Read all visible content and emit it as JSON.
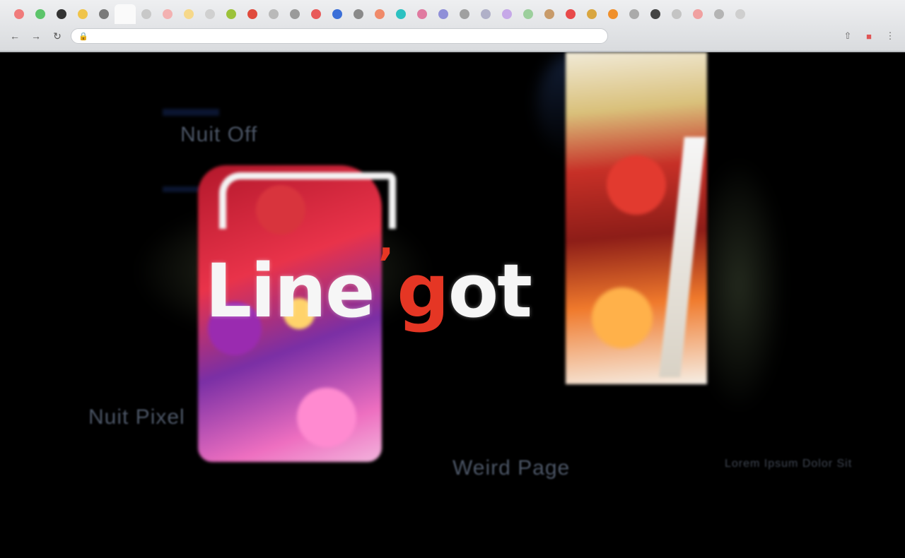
{
  "browser": {
    "tab_favicons": [
      {
        "name": "tab-1",
        "color": "#f07b7b"
      },
      {
        "name": "tab-2",
        "color": "#5cc46a"
      },
      {
        "name": "tab-3",
        "color": "#333333"
      },
      {
        "name": "tab-4",
        "color": "#f0c44a"
      },
      {
        "name": "tab-5",
        "color": "#7a7a7a"
      },
      {
        "name": "tab-6",
        "color": "#fafafa"
      },
      {
        "name": "tab-7",
        "color": "#c8c8c8"
      },
      {
        "name": "tab-8",
        "color": "#f3b1b1"
      },
      {
        "name": "tab-9",
        "color": "#f6d88a"
      },
      {
        "name": "tab-10",
        "color": "#d0d0d0"
      },
      {
        "name": "tab-11",
        "color": "#9cc23a"
      },
      {
        "name": "tab-12",
        "color": "#e04a3c"
      },
      {
        "name": "tab-13",
        "color": "#b9b9b9"
      },
      {
        "name": "tab-14",
        "color": "#9a9a9a"
      },
      {
        "name": "tab-15",
        "color": "#e85a5a"
      },
      {
        "name": "tab-16",
        "color": "#3b6fd8"
      },
      {
        "name": "tab-17",
        "color": "#8a8a8a"
      },
      {
        "name": "tab-18",
        "color": "#f08a6a"
      },
      {
        "name": "tab-19",
        "color": "#2cc1c1"
      },
      {
        "name": "tab-20",
        "color": "#e07aa0"
      },
      {
        "name": "tab-21",
        "color": "#8f8fd8"
      },
      {
        "name": "tab-22",
        "color": "#a0a0a0"
      },
      {
        "name": "tab-23",
        "color": "#b0b0c8"
      },
      {
        "name": "tab-24",
        "color": "#c6a8e8"
      },
      {
        "name": "tab-25",
        "color": "#9ccf9c"
      },
      {
        "name": "tab-26",
        "color": "#c89b6a"
      },
      {
        "name": "tab-27",
        "color": "#e84a4a"
      },
      {
        "name": "tab-28",
        "color": "#d9a640"
      },
      {
        "name": "tab-29",
        "color": "#f0902c"
      },
      {
        "name": "tab-30",
        "color": "#aaaaaa"
      },
      {
        "name": "tab-31",
        "color": "#444444"
      },
      {
        "name": "tab-32",
        "color": "#c4c4c4"
      },
      {
        "name": "tab-33",
        "color": "#f0a0a0"
      },
      {
        "name": "tab-34",
        "color": "#b4b4b4"
      },
      {
        "name": "tab-35",
        "color": "#cfcfcf"
      }
    ],
    "url": "",
    "nav_icons": {
      "back": "back-icon",
      "forward": "forward-icon",
      "reload": "reload-icon"
    }
  },
  "page": {
    "logo": {
      "part1": "Line",
      "part2": "g",
      "part3": "ot"
    },
    "links": {
      "top_left": "Nuit Off",
      "bottom_left": "Nuit Pixel",
      "bottom_center": "Weird Page",
      "bottom_right": "Lorem Ipsum Dolor Sit"
    }
  }
}
